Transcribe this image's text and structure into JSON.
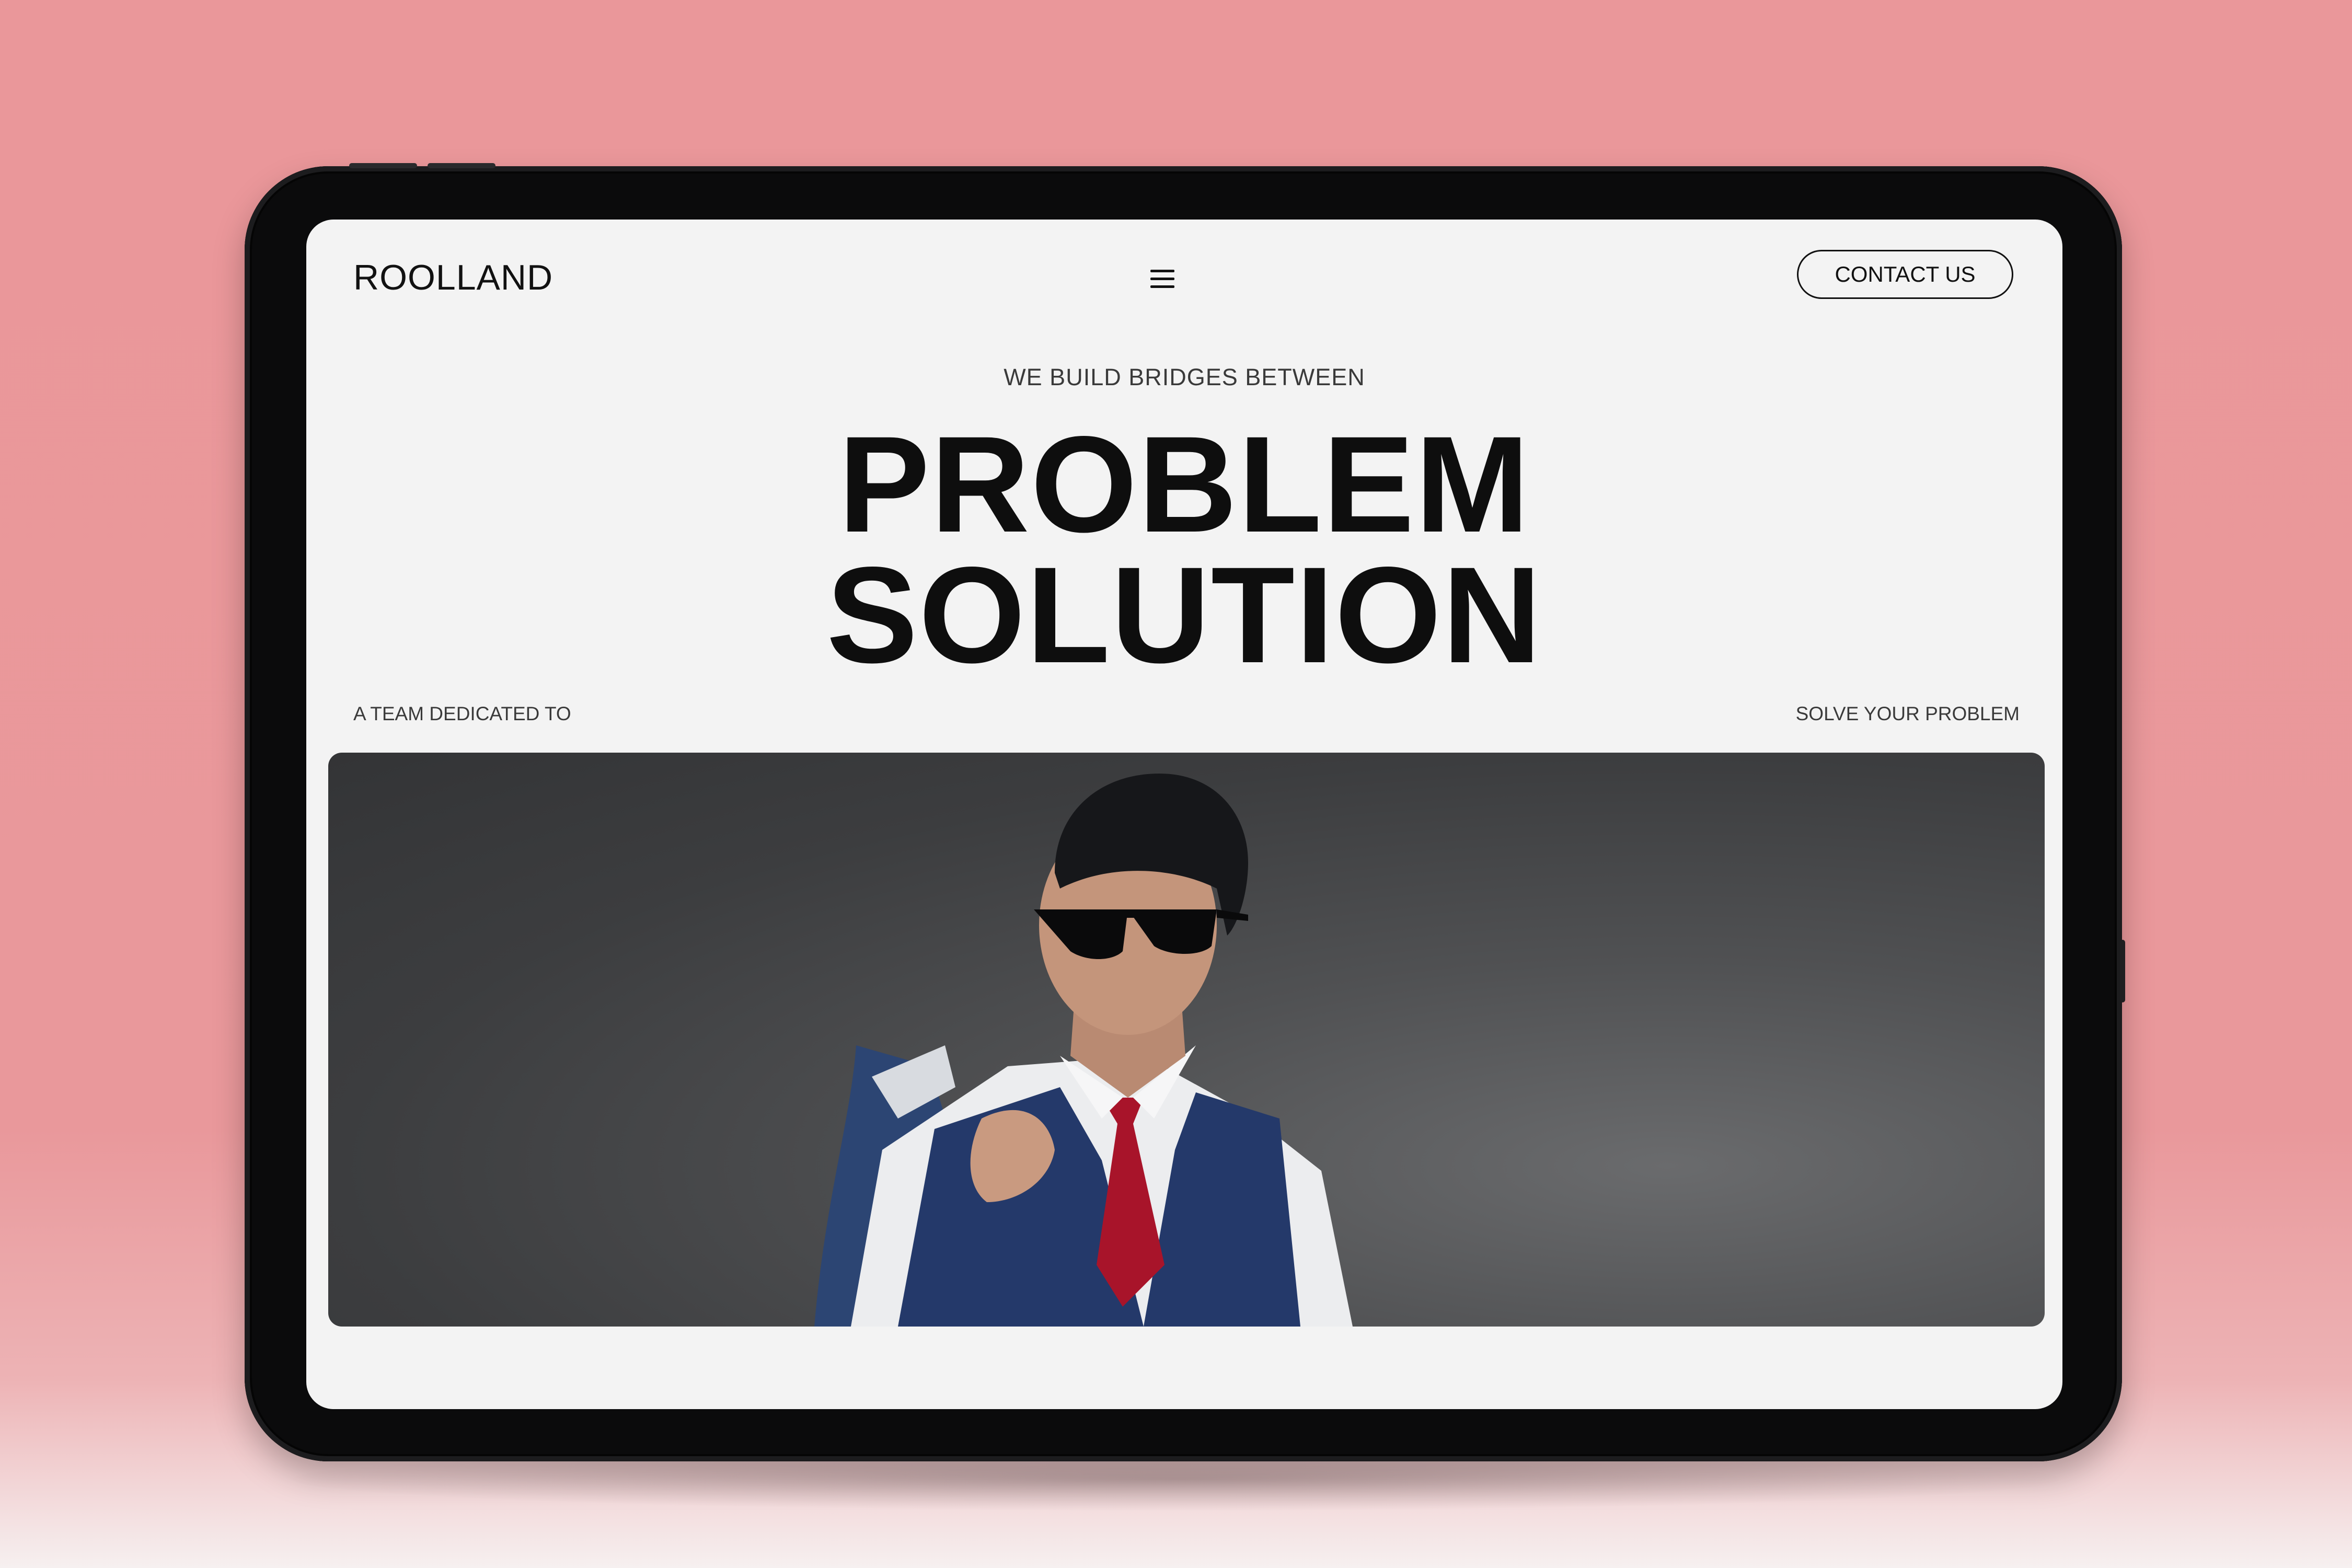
{
  "brand": {
    "logo": "ROOLLAND"
  },
  "nav": {
    "menu_icon": "hamburger-menu-icon",
    "contact_label": "CONTACT US"
  },
  "hero": {
    "eyebrow": "WE BUILD BRIDGES BETWEEN",
    "headline_line1": "PROBLEM",
    "headline_line2": "SOLUTION",
    "tagline_left": "A TEAM DEDICATED TO",
    "tagline_right": "SOLVE YOUR PROBLEM"
  },
  "colors": {
    "background": "#ea979a",
    "screen": "#f3f3f3",
    "text": "#111111",
    "tablet_bezel": "#0b0b0c",
    "photo_backdrop": "#3c3d3f"
  }
}
